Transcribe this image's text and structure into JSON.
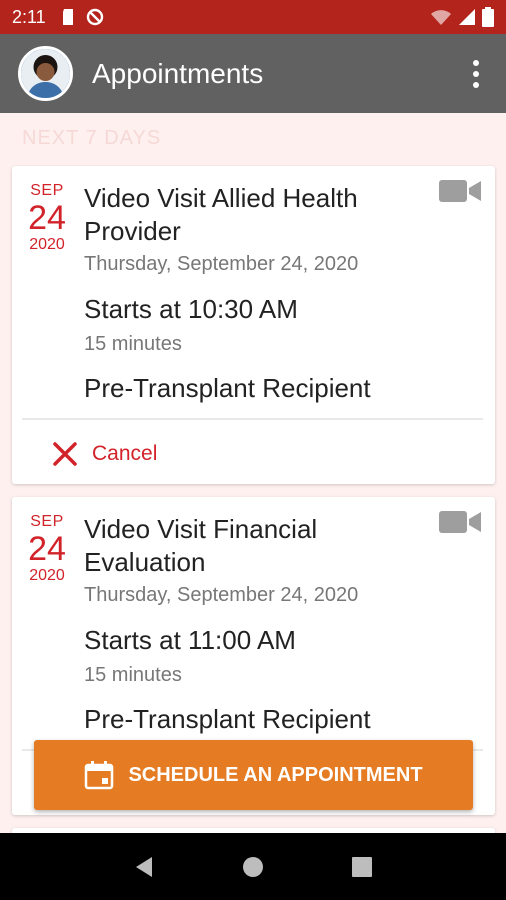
{
  "status_bar": {
    "time": "2:11",
    "icons": [
      "sd-card-icon",
      "no-sync-icon",
      "wifi-icon",
      "signal-icon",
      "battery-icon"
    ]
  },
  "app_bar": {
    "title": "Appointments",
    "menu_icon": "more-vert-icon"
  },
  "section_label": "NEXT 7 DAYS",
  "appointments": [
    {
      "month": "SEP",
      "day": "24",
      "year": "2020",
      "title": "Video Visit Allied Health Provider",
      "date_text": "Thursday, September 24, 2020",
      "start_text": "Starts at 10:30 AM",
      "duration_text": "15 minutes",
      "type_text": "Pre-Transplant Recipient",
      "cancel_label": "Cancel"
    },
    {
      "month": "SEP",
      "day": "24",
      "year": "2020",
      "title": "Video Visit Financial Evaluation",
      "date_text": "Thursday, September 24, 2020",
      "start_text": "Starts at 11:00 AM",
      "duration_text": "15 minutes",
      "type_text": "Pre-Transplant Recipient"
    }
  ],
  "schedule_button": {
    "label": "SCHEDULE AN APPOINTMENT"
  },
  "colors": {
    "status_bar": "#b3241c",
    "app_bar": "#616161",
    "accent_red": "#d2232a",
    "schedule_orange": "#e57b22",
    "background": "#fdf0ef"
  }
}
